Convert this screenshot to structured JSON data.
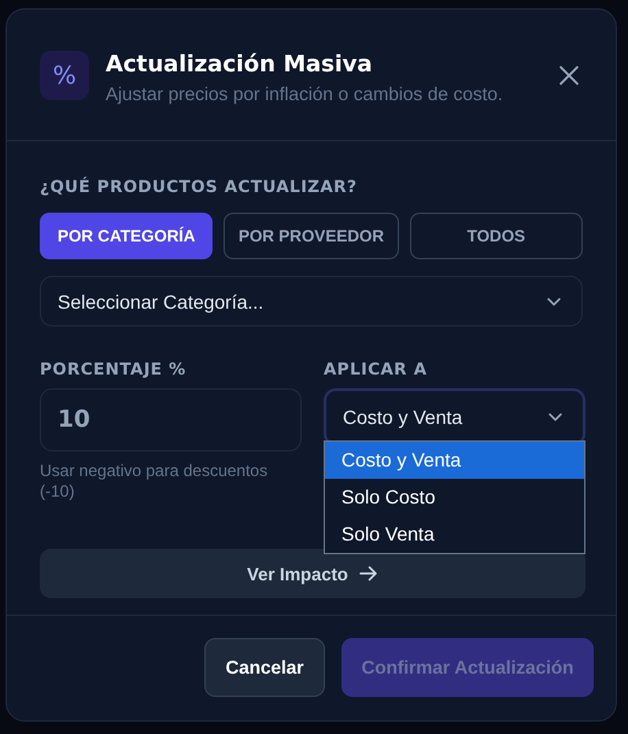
{
  "dialog": {
    "title": "Actualización Masiva",
    "subtitle": "Ajustar precios por inflación o cambios de costo.",
    "icon": "%"
  },
  "scope": {
    "label": "¿QUÉ PRODUCTOS ACTUALIZAR?",
    "tabs": [
      {
        "label": "POR CATEGORÍA",
        "selected": true
      },
      {
        "label": "POR PROVEEDOR",
        "selected": false
      },
      {
        "label": "TODOS",
        "selected": false
      }
    ],
    "category_select": {
      "value": "Seleccionar Categoría..."
    }
  },
  "percentage": {
    "label": "PORCENTAJE %",
    "value": "10",
    "hint": "Usar negativo para descuentos (-10)"
  },
  "apply_to": {
    "label": "APLICAR A",
    "value": "Costo y Venta",
    "expanded": true,
    "options": [
      {
        "label": "Costo y Venta",
        "selected": true
      },
      {
        "label": "Solo Costo",
        "selected": false
      },
      {
        "label": "Solo Venta",
        "selected": false
      }
    ]
  },
  "impact_button": {
    "label": "Ver Impacto"
  },
  "buttons": [
    {
      "kind": "secondary",
      "label": "Cancelar",
      "disabled": false
    },
    {
      "kind": "primary",
      "label": "Confirmar Actualización",
      "disabled": true
    }
  ]
}
